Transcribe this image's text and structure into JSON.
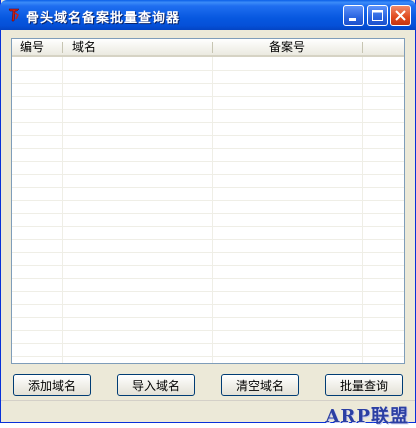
{
  "window": {
    "title": "骨头域名备案批量查询器",
    "icon": "app-icon"
  },
  "titlebar_buttons": {
    "minimize_icon": "minimize-icon",
    "maximize_icon": "maximize-icon",
    "close_icon": "close-icon"
  },
  "list": {
    "columns": [
      {
        "label": "编号"
      },
      {
        "label": "域名"
      },
      {
        "label": "备案号"
      }
    ],
    "rows": []
  },
  "buttons": {
    "add_domain": "添加域名",
    "import_domain": "导入域名",
    "clear_domain": "清空域名",
    "batch_query": "批量查询"
  },
  "status": {
    "watermark": "ARP联盟"
  },
  "colors": {
    "titlebar": "#0758E0",
    "window_bg": "#ECE9D8",
    "list_border": "#7F9DB9",
    "watermark": "#2B3FA3"
  }
}
